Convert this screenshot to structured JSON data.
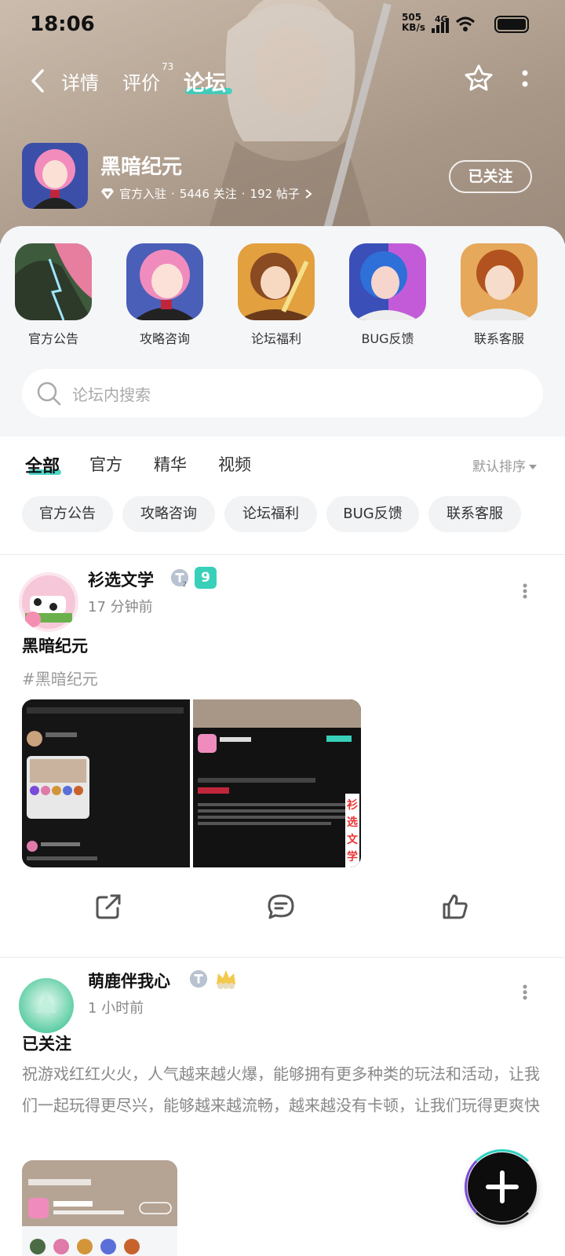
{
  "status_bar": {
    "time": "18:06",
    "net_speed": "505",
    "net_unit": "KB/s",
    "net_type": "4G",
    "sim": "6"
  },
  "nav": {
    "tabs": [
      {
        "label": "详情"
      },
      {
        "label": "评价",
        "badge": "73"
      },
      {
        "label": "论坛"
      }
    ]
  },
  "game": {
    "title": "黑暗纪元",
    "official": "官方入驻",
    "followers": "5446 关注",
    "posts": "192 帖子",
    "follow_label": "已关注"
  },
  "categories": [
    {
      "label": "官方公告",
      "color": "#4a6b43"
    },
    {
      "label": "攻略咨询",
      "color": "#e07aa8"
    },
    {
      "label": "论坛福利",
      "color": "#d3953a"
    },
    {
      "label": "BUG反馈",
      "color": "#5b6fd9"
    },
    {
      "label": "联系客服",
      "color": "#c8622d"
    }
  ],
  "search": {
    "placeholder": "论坛内搜索"
  },
  "filter_tabs": [
    "全部",
    "官方",
    "精华",
    "视频"
  ],
  "sort_label": "默认排序",
  "chips": [
    "官方公告",
    "攻略咨询",
    "论坛福利",
    "BUG反馈",
    "联系客服"
  ],
  "posts": [
    {
      "author": "衫选文学",
      "time": "17 分钟前",
      "level": "9",
      "title": "黑暗纪元",
      "tag": "#黑暗纪元",
      "watermark": [
        "衫",
        "选",
        "文",
        "学"
      ]
    },
    {
      "author": "萌鹿伴我心",
      "time": "1 小时前",
      "title": "已关注",
      "body": "祝游戏红红火火，人气越来越火爆，能够拥有更多种类的玩法和活动，让我们一起玩得更尽兴，能够越来越流畅，越来越没有卡顿，让我们玩得更爽快"
    }
  ],
  "colors": {
    "accent": "#2fd0c0",
    "hero": "#b5a494"
  }
}
